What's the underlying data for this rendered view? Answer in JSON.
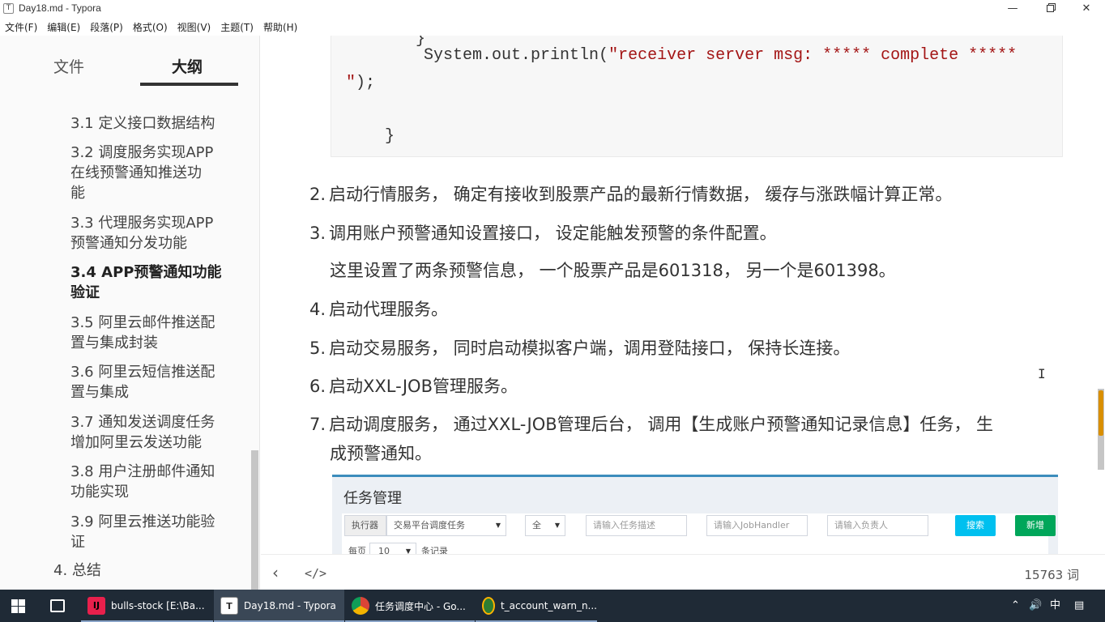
{
  "window": {
    "title": "Day18.md - Typora",
    "app_icon_letter": "T"
  },
  "menu": [
    "文件(F)",
    "编辑(E)",
    "段落(P)",
    "格式(O)",
    "视图(V)",
    "主题(T)",
    "帮助(H)"
  ],
  "sidebar": {
    "tab_files": "文件",
    "tab_outline": "大纲",
    "items": [
      "3.1 定义接口数据结构",
      "3.2 调度服务实现APP",
      "在线预警通知推送功",
      "能",
      "3.3 代理服务实现APP",
      "预警通知分发功能",
      "3.4 APP预警通知功能",
      "验证",
      "3.5 阿里云邮件推送配",
      "置与集成封装",
      "3.6 阿里云短信推送配",
      "置与集成",
      "3.7 通知发送调度任务",
      "增加阿里云发送功能",
      "3.8 用户注册邮件通知",
      "功能实现",
      "3.9 阿里云推送功能验",
      "证",
      "4. 总结"
    ]
  },
  "code": {
    "line1_indent": "        System.out.println(",
    "line1_string": "\"receiver server msg: ***** complete *****",
    "line2_string": "\"",
    "line2_rest": ");",
    "line3": "    }"
  },
  "content": {
    "item2": "启动行情服务， 确定有接收到股票产品的最新行情数据， 缓存与涨跌幅计算正常。",
    "item3": "调用账户预警通知设置接口， 设定能触发预警的条件配置。",
    "item3_note": "这里设置了两条预警信息， 一个股票产品是601318， 另一个是601398。",
    "item4": "启动代理服务。",
    "item5": "启动交易服务， 同时启动模拟客户端，调用登陆接口， 保持长连接。",
    "item6": "启动XXL-JOB管理服务。",
    "item7_line1": "启动调度服务， 通过XXL-JOB管理后台， 调用【生成账户预警通知记录信息】任务， 生",
    "item7_line2": "成预警通知。",
    "num2": "2.",
    "num3": "3.",
    "num4": "4.",
    "num5": "5.",
    "num6": "6.",
    "num7": "7."
  },
  "embed": {
    "title": "任务管理",
    "executor_label": "执行器",
    "executor_value": "交易平台调度任务",
    "status_value": "全",
    "task_desc_placeholder": "请输入任务描述",
    "jobhandler_placeholder": "请输入JobHandler",
    "owner_placeholder": "请输入负责人",
    "search_btn": "搜索",
    "add_btn": "新增",
    "per_page_label": "每页",
    "per_page_value": "10",
    "records_label": "条记录"
  },
  "statusbar": {
    "word_count": "15763 词"
  },
  "taskbar": {
    "tasks": [
      {
        "label": "bulls-stock [E:\\Ba...",
        "icon": "intellij-icon"
      },
      {
        "label": "Day18.md - Typora",
        "icon": "typora-icon"
      },
      {
        "label": "任务调度中心 - Go...",
        "icon": "chrome-icon"
      },
      {
        "label": "t_account_warn_n...",
        "icon": "navicat-icon"
      }
    ],
    "ime": "中"
  },
  "colors": {
    "code_string": "#a31515",
    "embed_accent": "#3c8dbc",
    "search_btn": "#00c0ef",
    "add_btn": "#00a65a",
    "taskbar_bg": "#1f2a36",
    "scroll_thumb": "#d98f00"
  }
}
